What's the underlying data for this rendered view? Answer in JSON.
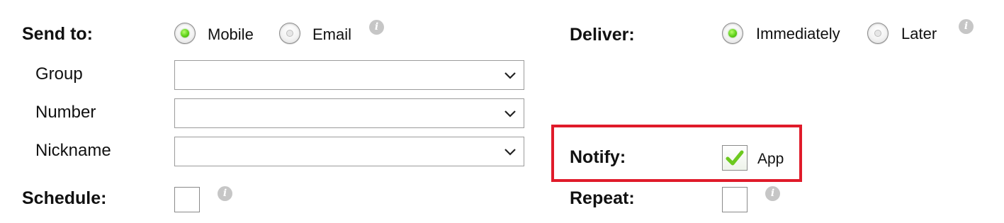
{
  "send_to": {
    "label": "Send to:",
    "options": [
      {
        "label": "Mobile",
        "selected": true
      },
      {
        "label": "Email",
        "selected": false
      }
    ],
    "info_icon": "info-icon"
  },
  "fields": [
    {
      "label": "Group",
      "value": ""
    },
    {
      "label": "Number",
      "value": ""
    },
    {
      "label": "Nickname",
      "value": ""
    }
  ],
  "schedule": {
    "label": "Schedule:",
    "checked": false
  },
  "deliver": {
    "label": "Deliver:",
    "options": [
      {
        "label": "Immediately",
        "selected": true
      },
      {
        "label": "Later",
        "selected": false
      }
    ]
  },
  "notify": {
    "label": "Notify:",
    "option_label": "App",
    "checked": true,
    "highlight_color": "#e01b2a"
  },
  "repeat": {
    "label": "Repeat:",
    "checked": false
  },
  "colors": {
    "radio_selected": "#5fd11a",
    "checkmark": "#6cc91e",
    "info_icon": "#c6c6c6"
  }
}
